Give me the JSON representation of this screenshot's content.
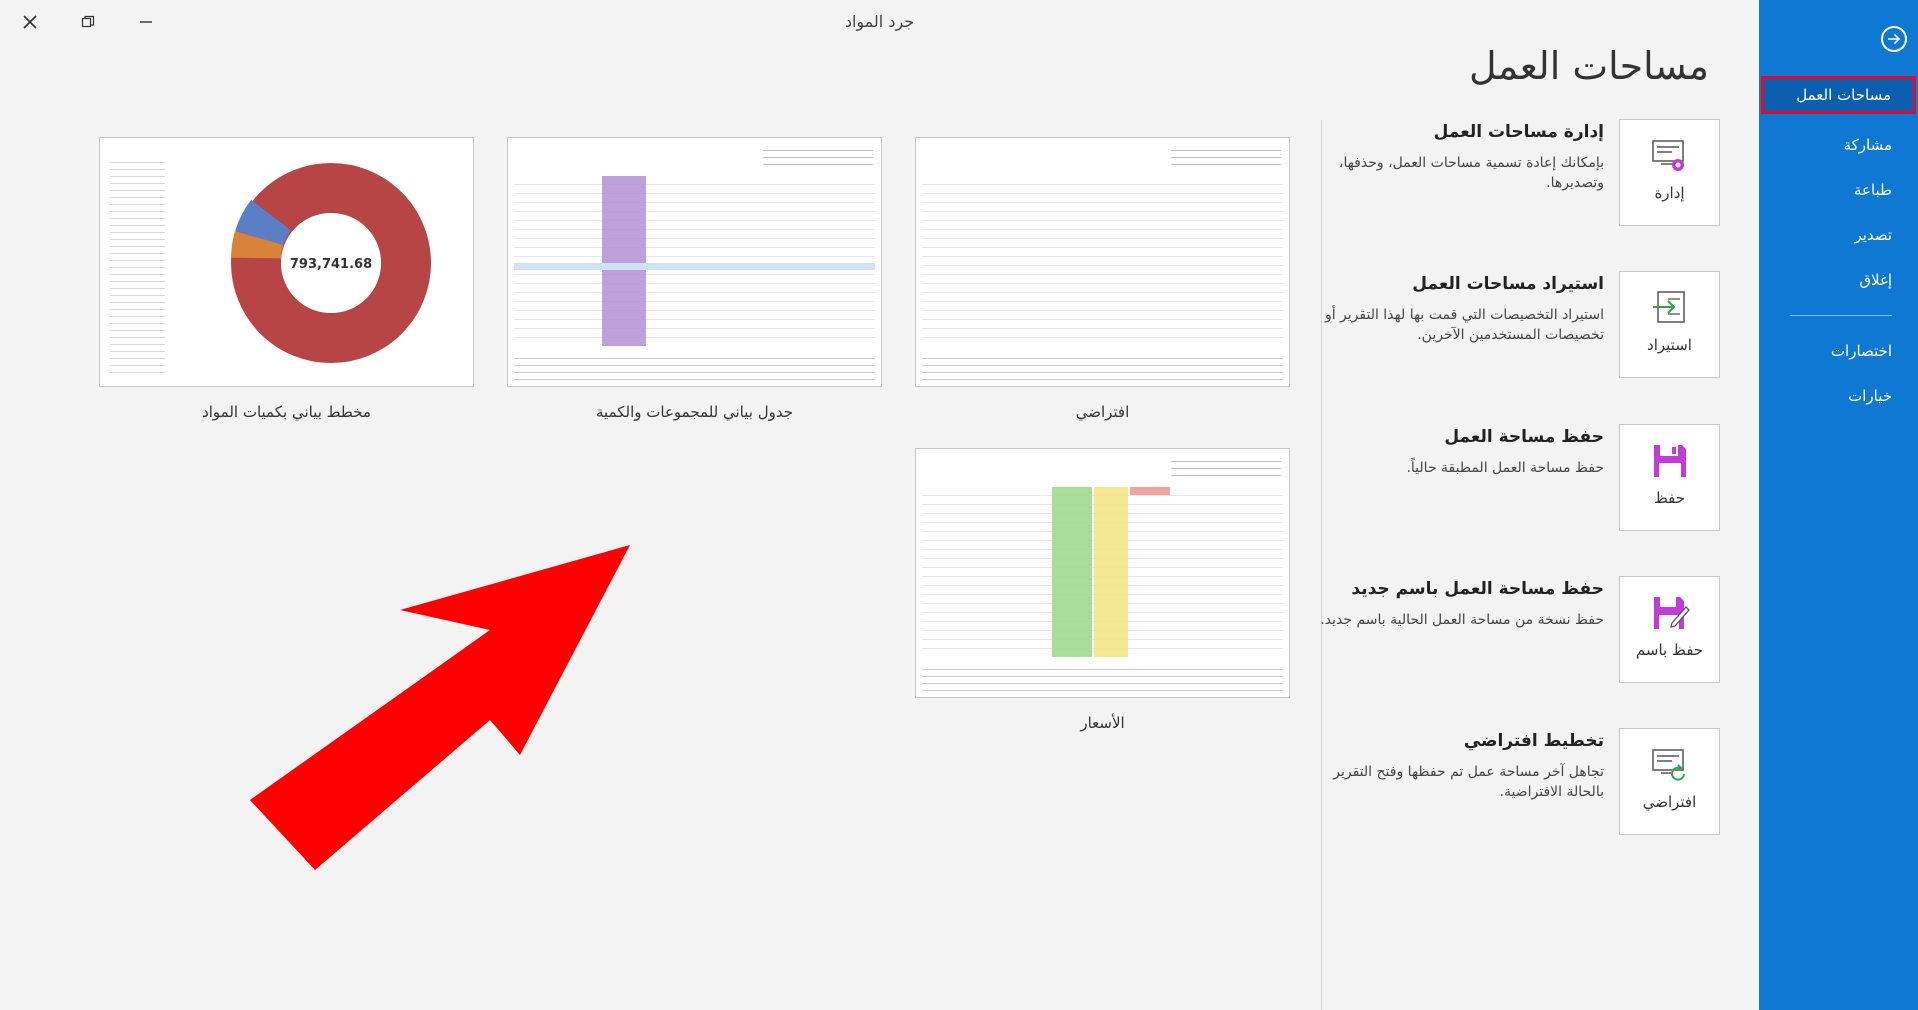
{
  "window": {
    "title": "جرد المواد"
  },
  "sidebar": {
    "items": [
      {
        "label": "مساحات العمل",
        "active": true
      },
      {
        "label": "مشاركة"
      },
      {
        "label": "طباعة"
      },
      {
        "label": "تصدير"
      },
      {
        "label": "إغلاق"
      }
    ],
    "bottom_items": [
      {
        "label": "اختصارات"
      },
      {
        "label": "خيارات"
      }
    ]
  },
  "page": {
    "title": "مساحات العمل"
  },
  "actions": [
    {
      "button": "إدارة",
      "title": "إدارة مساحات العمل",
      "description": "بإمكانك إعادة تسمية مساحات العمل، وحذفها، وتصديرها.",
      "icon": "manage-workspace-icon"
    },
    {
      "button": "استيراد",
      "title": "استيراد مساحات العمل",
      "description": "استيراد التخصيصات التي قمت بها لهذا التقرير أو تخصيصات المستخدمين الآخرين.",
      "icon": "import-icon"
    },
    {
      "button": "حفظ",
      "title": "حفظ مساحة العمل",
      "description": "حفظ مساحة العمل المطبقة حالياً.",
      "icon": "save-icon"
    },
    {
      "button": "حفظ باسم",
      "title": "حفظ مساحة العمل باسم جديد",
      "description": "حفظ نسخة من مساحة العمل الحالية باسم جديد.",
      "icon": "save-as-icon"
    },
    {
      "button": "افتراضي",
      "title": "تخطيط افتراضي",
      "description": "تجاهل آخر مساحة عمل تم حفظها وفتح التقرير بالحالة الافتراضية.",
      "icon": "reset-layout-icon"
    }
  ],
  "workspaces": [
    {
      "label": "افتراضي"
    },
    {
      "label": "جدول بياني للمجموعات والكمية"
    },
    {
      "label": "مخطط بياني بكميات المواد",
      "center_value": "793,741.68"
    },
    {
      "label": "الأسعار"
    }
  ],
  "colors": {
    "sidebar": "#0f78d3",
    "highlight_border": "#e00b2b",
    "arrow": "#ff0000",
    "donut": "#b84545"
  }
}
